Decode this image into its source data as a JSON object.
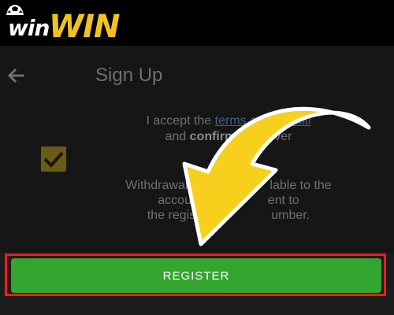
{
  "header": {
    "logo_prefix": "win",
    "logo_main": "WIN"
  },
  "signup": {
    "title": "Sign Up",
    "back_icon": "arrow-left-icon",
    "terms_prefix": "I accept the ",
    "terms_link": "terms and conditi",
    "terms_line2_prefix": "and ",
    "terms_confirm": "confirm",
    "terms_line2_suffix": " I am over",
    "checkbox_checked": true,
    "withdraw_line1": "Withdrawals",
    "withdraw_line1_suffix": "lable to the",
    "withdraw_line2_prefix": "account h",
    "withdraw_line2_suffix": "ent to",
    "withdraw_line3_prefix": "the regis",
    "withdraw_line3_suffix": "umber."
  },
  "actions": {
    "register_label": "REGISTER"
  },
  "colors": {
    "brand_gold": "#f2c21b",
    "register_green": "#34a630",
    "highlight_red": "#ee1c1c",
    "arrow_yellow": "#f7cf1d"
  }
}
